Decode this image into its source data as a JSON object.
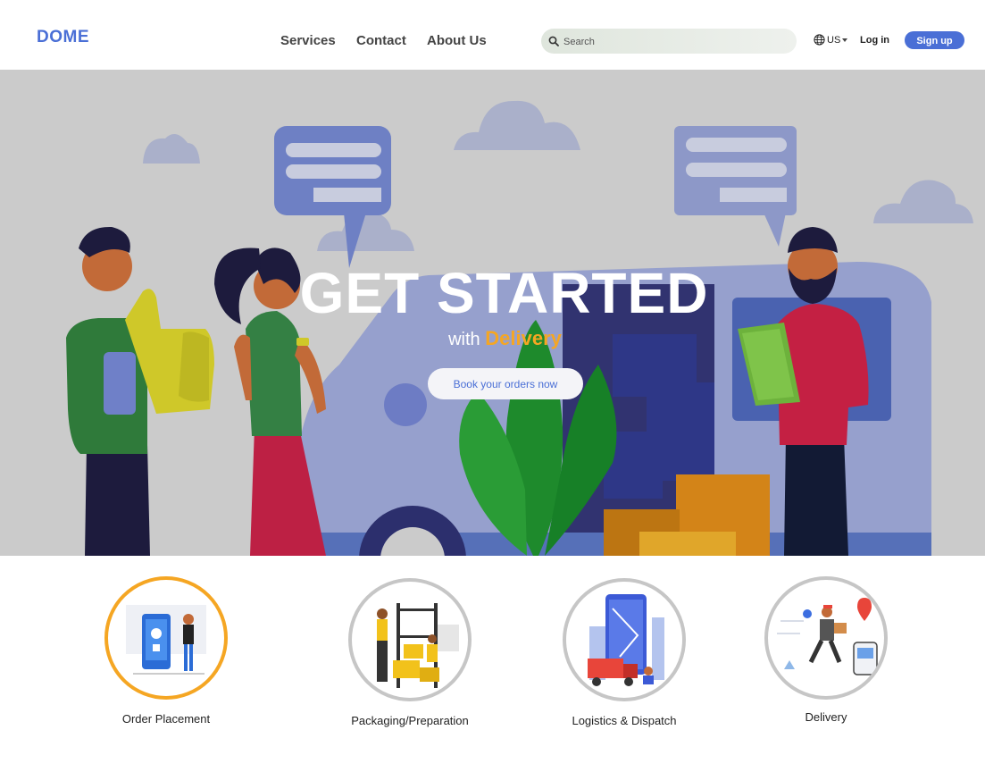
{
  "header": {
    "logo": "DOME",
    "nav": [
      "Services",
      "Contact",
      "About Us"
    ],
    "search_placeholder": "Search",
    "language": "US",
    "login": "Log in",
    "signup": "Sign up"
  },
  "hero": {
    "title": "GET STARTED",
    "subtitle_prefix": "with",
    "subtitle_highlight": "Delivery",
    "cta": "Book your orders now"
  },
  "steps": [
    {
      "label": "Order Placement",
      "active": true
    },
    {
      "label": "Packaging/Preparation",
      "active": false
    },
    {
      "label": "Logistics & Dispatch",
      "active": false
    },
    {
      "label": "Delivery",
      "active": false
    }
  ],
  "colors": {
    "brand": "#4a6fd6",
    "accent": "#f5a623",
    "hero_bg": "#cbcbcb"
  }
}
